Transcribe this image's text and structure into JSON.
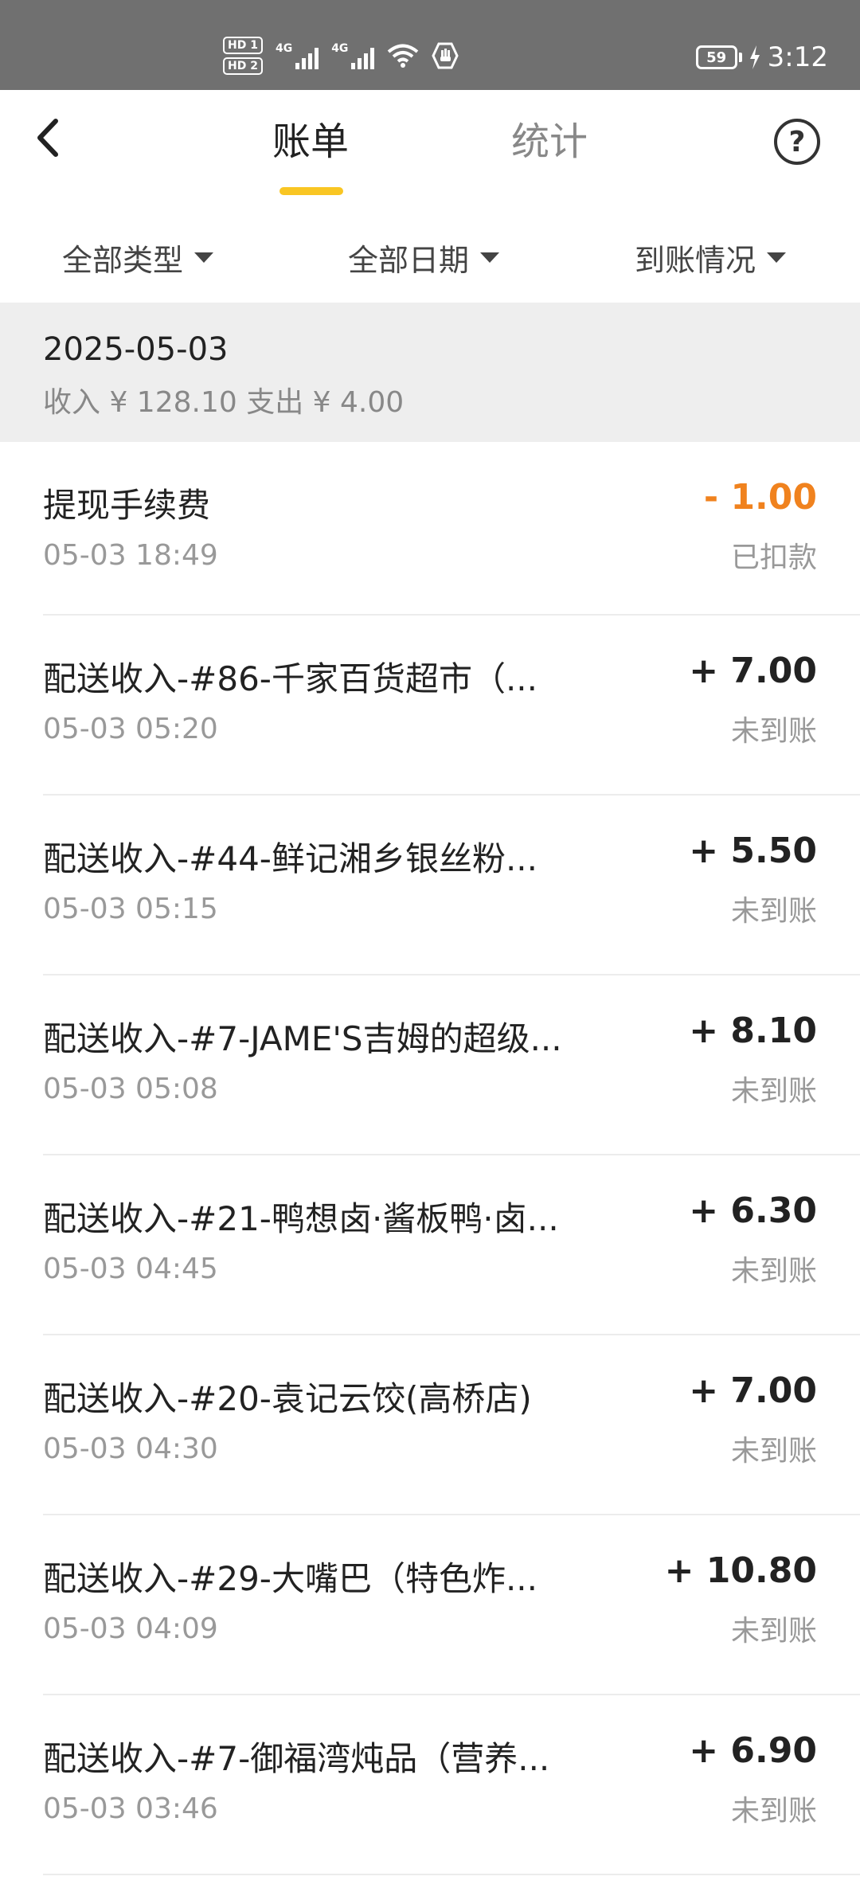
{
  "status_bar": {
    "hd1": "HD 1",
    "hd2": "HD 2",
    "net1": "4G",
    "net2": "4G",
    "battery": "59",
    "time": "3:12"
  },
  "header": {
    "tabs": [
      {
        "label": "账单",
        "active": true
      },
      {
        "label": "统计",
        "active": false
      }
    ],
    "help_symbol": "?",
    "accent_color": "#f9c623"
  },
  "filters": [
    {
      "label": "全部类型"
    },
    {
      "label": "全部日期"
    },
    {
      "label": "到账情况"
    }
  ],
  "date_group": {
    "date": "2025-05-03",
    "summary": "收入 ¥ 128.10 支出 ¥ 4.00"
  },
  "transactions": [
    {
      "title": "提现手续费",
      "time": "05-03 18:49",
      "amount": "- 1.00",
      "status": "已扣款",
      "negative": true
    },
    {
      "title": "配送收入-#86-千家百货超市（...",
      "time": "05-03 05:20",
      "amount": "+ 7.00",
      "status": "未到账",
      "negative": false
    },
    {
      "title": "配送收入-#44-鲜记湘乡银丝粉...",
      "time": "05-03 05:15",
      "amount": "+ 5.50",
      "status": "未到账",
      "negative": false
    },
    {
      "title": "配送收入-#7-JAME'S吉姆的超级...",
      "time": "05-03 05:08",
      "amount": "+ 8.10",
      "status": "未到账",
      "negative": false
    },
    {
      "title": "配送收入-#21-鸭想卤·酱板鸭·卤...",
      "time": "05-03 04:45",
      "amount": "+ 6.30",
      "status": "未到账",
      "negative": false
    },
    {
      "title": "配送收入-#20-袁记云饺(高桥店)",
      "time": "05-03 04:30",
      "amount": "+ 7.00",
      "status": "未到账",
      "negative": false
    },
    {
      "title": "配送收入-#29-大嘴巴（特色炸...",
      "time": "05-03 04:09",
      "amount": "+ 10.80",
      "status": "未到账",
      "negative": false
    },
    {
      "title": "配送收入-#7-御福湾炖品（营养...",
      "time": "05-03 03:46",
      "amount": "+ 6.90",
      "status": "未到账",
      "negative": false
    }
  ]
}
